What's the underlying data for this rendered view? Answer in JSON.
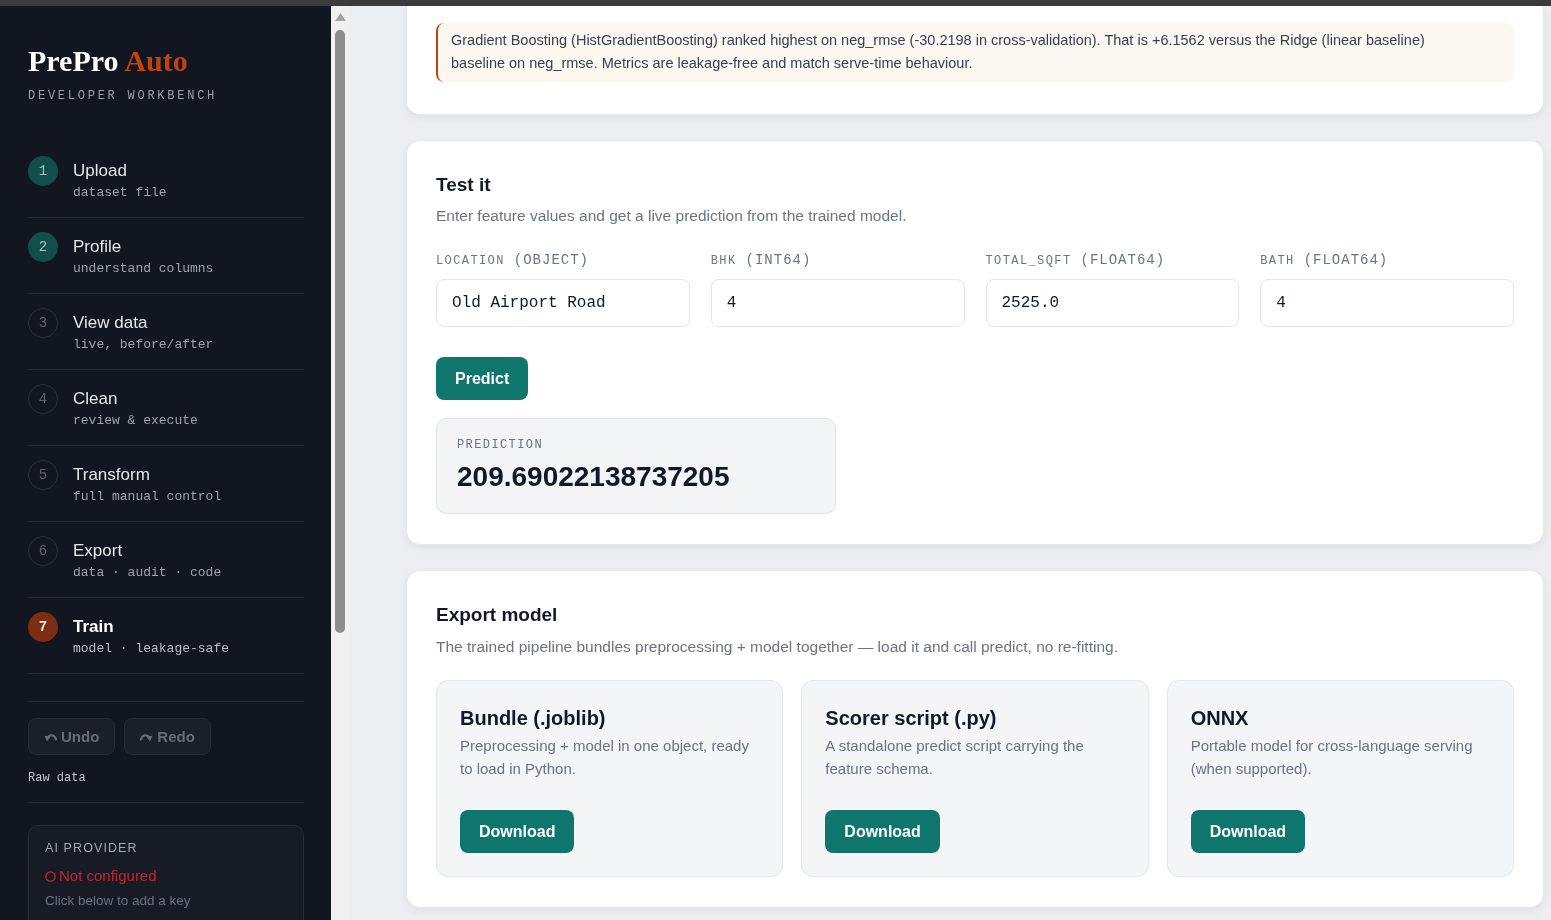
{
  "sidebar": {
    "logo": {
      "text": "PrePro",
      "accent": "Auto"
    },
    "tagline": "DEVELOPER WORKBENCH",
    "steps": [
      {
        "number": "1",
        "title": "Upload",
        "subtitle": "dataset file",
        "done": true,
        "selected": false
      },
      {
        "number": "2",
        "title": "Profile",
        "subtitle": "understand columns",
        "done": true,
        "selected": false
      },
      {
        "number": "3",
        "title": "View data",
        "subtitle": "live, before/after",
        "done": false,
        "selected": false
      },
      {
        "number": "4",
        "title": "Clean",
        "subtitle": "review & execute",
        "done": false,
        "selected": false
      },
      {
        "number": "5",
        "title": "Transform",
        "subtitle": "full manual control",
        "done": false,
        "selected": false
      },
      {
        "number": "6",
        "title": "Export",
        "subtitle": "data · audit · code",
        "done": false,
        "selected": false
      },
      {
        "number": "7",
        "title": "Train",
        "subtitle": "model · leakage-safe",
        "done": false,
        "selected": true
      }
    ],
    "history_buttons": [
      {
        "kind": "undo",
        "label": "Undo",
        "disabled": true
      },
      {
        "kind": "redo",
        "label": "Redo",
        "disabled": true
      }
    ],
    "view_label": "Raw data",
    "ai_provider": {
      "heading": "AI PROVIDER",
      "status": "Not configured",
      "hint": "Click below to add a key"
    }
  },
  "main": {
    "summary": "Gradient Boosting (HistGradientBoosting) ranked highest on neg_rmse (-30.2198 in cross-validation). That is +6.1562 versus the Ridge (linear baseline) baseline on neg_rmse. Metrics are leakage-free and match serve-time behaviour.",
    "test_panel": {
      "title": "Test it",
      "description": "Enter feature values and get a live prediction from the trained model.",
      "fields": [
        {
          "name": "LOCATION",
          "dtype": "(OBJECT)",
          "value": "Old Airport Road"
        },
        {
          "name": "BHK",
          "dtype": "(INT64)",
          "value": "4"
        },
        {
          "name": "TOTAL_SQFT",
          "dtype": "(FLOAT64)",
          "value": "2525.0"
        },
        {
          "name": "BATH",
          "dtype": "(FLOAT64)",
          "value": "4"
        }
      ],
      "button": "Predict",
      "prediction": {
        "label": "PREDICTION",
        "value": "209.69022138737205"
      }
    },
    "export_panel": {
      "title": "Export model",
      "description": "The trained pipeline bundles preprocessing + model together — load it and call predict, no re-fitting.",
      "options": [
        {
          "title": "Bundle (.joblib)",
          "description": "Preprocessing + model in one object, ready to load in Python.",
          "button": "Download"
        },
        {
          "title": "Scorer script (.py)",
          "description": "A standalone predict script carrying the feature schema.",
          "button": "Download"
        },
        {
          "title": "ONNX",
          "description": "Portable model for cross-language serving (when supported).",
          "button": "Download"
        }
      ]
    }
  }
}
